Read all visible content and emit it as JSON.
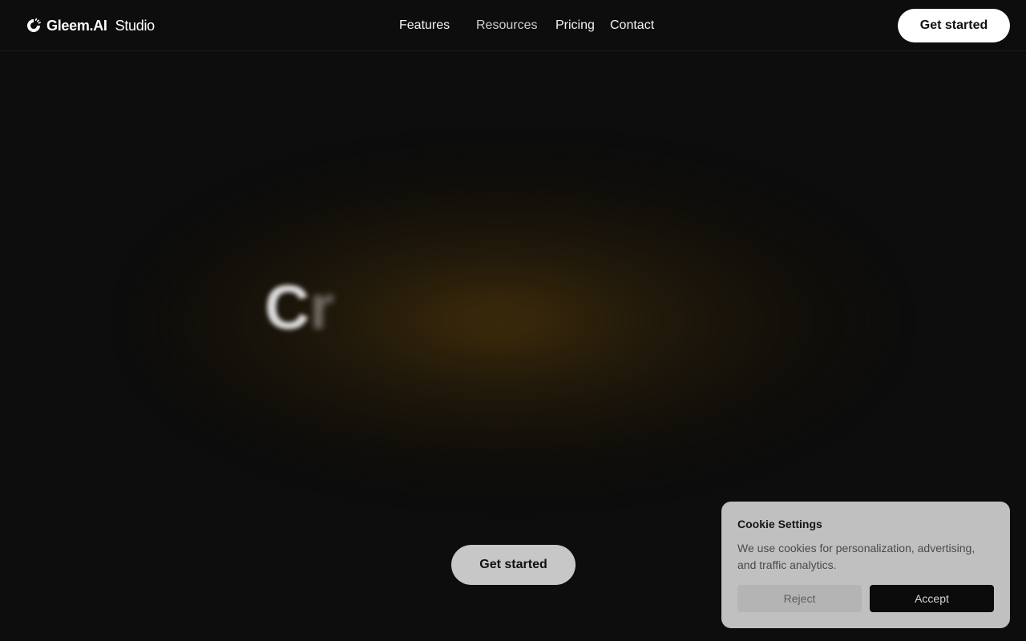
{
  "nav": {
    "brand_bold": "Gleem.AI",
    "brand_light": "Studio",
    "items": [
      {
        "label": "Features"
      },
      {
        "label": "Resources"
      },
      {
        "label": "Pricing"
      },
      {
        "label": "Contact"
      }
    ],
    "cta": "Get started"
  },
  "hero": {
    "letters": [
      "C",
      "r"
    ],
    "cta": "Get started"
  },
  "cookie": {
    "title": "Cookie Settings",
    "description": "We use cookies for personalization, advertising, and traffic analytics.",
    "reject": "Reject",
    "accept": "Accept"
  },
  "colors": {
    "background": "#0d0d0d",
    "glow": "#503708",
    "cookie_bg": "#c0c0c0",
    "accept_bg": "#0b0b0b"
  },
  "icons": {
    "brand": "spinner-logo-icon"
  }
}
